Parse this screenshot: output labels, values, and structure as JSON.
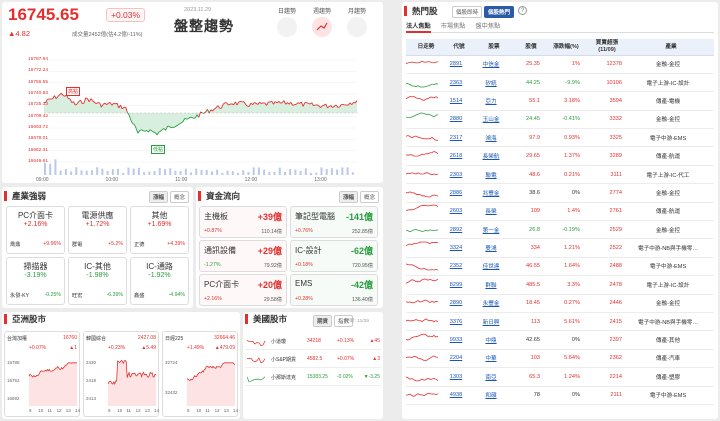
{
  "index": {
    "value": "16745.65",
    "pct": "+0.03%",
    "change": "▲4.82",
    "date": "2023.11.29",
    "volume": "成交量2452億(估4.2億/-11%)",
    "title": "盤整趨勢"
  },
  "views": [
    {
      "label": "日趨勢"
    },
    {
      "label": "週趨勢"
    },
    {
      "label": "月趨勢"
    }
  ],
  "main_chart": {
    "yticks": [
      "16787.94",
      "16772.24",
      "16756.55",
      "16740.83",
      "16725.13",
      "16709.42",
      "16693.72",
      "16678.01",
      "16662.31",
      "16646.61"
    ],
    "xticks": [
      "09:00",
      "10:00",
      "11:00",
      "12:00",
      "13:00"
    ],
    "high_label": "高點",
    "low_label": "低點"
  },
  "industry": {
    "title": "產業強弱",
    "tab1": "漲幅",
    "tab2": "概念",
    "cards": [
      {
        "name": "PC介面卡",
        "pct": "+2.16%",
        "stock": "喬鼎",
        "spct": "+9.96%",
        "dir": "up"
      },
      {
        "name": "電源供應",
        "pct": "+1.72%",
        "stock": "群電",
        "spct": "+5.2%",
        "dir": "up"
      },
      {
        "name": "其他",
        "pct": "+1.69%",
        "stock": "正德",
        "spct": "+4.39%",
        "dir": "up"
      },
      {
        "name": "掃描器",
        "pct": "-3.19%",
        "stock": "永發-KY",
        "spct": "-0.25%",
        "dir": "dn"
      },
      {
        "name": "IC-其他",
        "pct": "-1.98%",
        "stock": "旺宏",
        "spct": "-6.39%",
        "dir": "dn"
      },
      {
        "name": "IC-通路",
        "pct": "-1.92%",
        "stock": "鑫盛",
        "spct": "-4.94%",
        "dir": "dn"
      }
    ]
  },
  "capital": {
    "title": "資金流向",
    "tab1": "漲幅",
    "tab2": "概念",
    "cards": [
      {
        "name": "主機板",
        "amt": "+39億",
        "pct": "+0.87%",
        "val": "110.14億",
        "dir": "up"
      },
      {
        "name": "筆記型電腦",
        "amt": "-141億",
        "pct": "+0.76%",
        "val": "252.85億",
        "dir": "dn"
      },
      {
        "name": "通訊設備",
        "amt": "+29億",
        "pct": "-1.27%",
        "val": "79.92億",
        "dir": "up"
      },
      {
        "name": "IC-設計",
        "amt": "-62億",
        "pct": "+0.18%",
        "val": "720.95億",
        "dir": "dn"
      },
      {
        "name": "PC介面卡",
        "amt": "+20億",
        "pct": "+2.16%",
        "val": "29.58億",
        "dir": "up"
      },
      {
        "name": "EMS",
        "amt": "-42億",
        "pct": "+0.28%",
        "val": "136.40億",
        "dir": "dn"
      }
    ]
  },
  "asia": {
    "title": "亞洲股市",
    "charts": [
      {
        "name": "台灣加權",
        "value": "16760",
        "pct": "+0.07%",
        "chg": "▲1",
        "yt": [
          "16788",
          "16752",
          "16692"
        ],
        "dir": "up"
      },
      {
        "name": "韓國綜合",
        "value": "2427.08",
        "pct": "+0.23%",
        "chg": "▲5.49",
        "yt": [
          "2430",
          "2418",
          "2413"
        ],
        "dir": "up"
      },
      {
        "name": "日經225",
        "value": "32664.46",
        "pct": "+1.49%",
        "chg": "▲479.09",
        "yt": [
          "32724",
          "32432"
        ],
        "dir": "up"
      }
    ],
    "xt": [
      "9",
      "10",
      "11",
      "12",
      "13",
      "14"
    ]
  },
  "us": {
    "title": "美國股市",
    "tab1": "期貨",
    "tab2": "指數",
    "time": "更新: 11/29",
    "rows": [
      {
        "name": "小道瓊",
        "val": "34218",
        "pct": "+0.13%",
        "chg": "▲45",
        "dir": "up"
      },
      {
        "name": "小S&P期貨",
        "val": "4582.5",
        "pct": "+0.07%",
        "chg": "▲3",
        "dir": "up"
      },
      {
        "name": "小那斯達克",
        "val": "15383.25",
        "pct": "-0.02%",
        "chg": "▼-3.25",
        "dir": "dn"
      }
    ]
  },
  "hot": {
    "title": "熱門股",
    "tab1": "個股即時",
    "tab2": "個股熱門",
    "help": "?",
    "subtabs": [
      "法人焦點",
      "市場焦點",
      "盤中焦點"
    ],
    "headers": [
      "日走勢",
      "代號",
      "股票",
      "股價",
      "漲跌幅(%)",
      "買賣超張\n(11/09)",
      "產業"
    ],
    "rows": [
      {
        "code": "2891",
        "name": "中信金",
        "price": "25.35",
        "pct": "1%",
        "vol": "12378",
        "ind": "金融-金控",
        "dir": "up"
      },
      {
        "code": "2363",
        "name": "矽統",
        "price": "44.25",
        "pct": "-9.9%",
        "vol": "10106",
        "ind": "電子上游-IC-設計",
        "dir": "dn"
      },
      {
        "code": "1514",
        "name": "亞力",
        "price": "55.1",
        "pct": "3.18%",
        "vol": "3594",
        "ind": "傳產-電機",
        "dir": "up"
      },
      {
        "code": "2880",
        "name": "玉山金",
        "price": "24.45",
        "pct": "-0.41%",
        "vol": "3332",
        "ind": "金融-金控",
        "dir": "dn"
      },
      {
        "code": "2317",
        "name": "鴻海",
        "price": "97.9",
        "pct": "0.93%",
        "vol": "3325",
        "ind": "電子中游-EMS",
        "dir": "up"
      },
      {
        "code": "2618",
        "name": "長榮航",
        "price": "29.65",
        "pct": "1.37%",
        "vol": "3289",
        "ind": "傳產-航運",
        "dir": "up"
      },
      {
        "code": "2303",
        "name": "聯電",
        "price": "48.6",
        "pct": "0.21%",
        "vol": "3111",
        "ind": "電子上游-IC-代工",
        "dir": "up"
      },
      {
        "code": "2886",
        "name": "兆豐金",
        "price": "38.6",
        "pct": "0%",
        "vol": "2774",
        "ind": "金融-金控",
        "dir": "flat"
      },
      {
        "code": "2603",
        "name": "長榮",
        "price": "109",
        "pct": "1.4%",
        "vol": "2761",
        "ind": "傳產-航運",
        "dir": "up"
      },
      {
        "code": "2892",
        "name": "第一金",
        "price": "26.8",
        "pct": "-0.19%",
        "vol": "2529",
        "ind": "金融-金控",
        "dir": "dn"
      },
      {
        "code": "3324",
        "name": "雙鴻",
        "price": "334",
        "pct": "1.21%",
        "vol": "2522",
        "ind": "電子中游-NB與手機零…",
        "dir": "up"
      },
      {
        "code": "2352",
        "name": "佳世達",
        "price": "46.55",
        "pct": "1.64%",
        "vol": "2488",
        "ind": "電子中游-EMS",
        "dir": "up"
      },
      {
        "code": "8299",
        "name": "群聯",
        "price": "485.5",
        "pct": "3.3%",
        "vol": "2478",
        "ind": "電子上游-IC-設計",
        "dir": "up"
      },
      {
        "code": "2890",
        "name": "永豐金",
        "price": "18.45",
        "pct": "0.27%",
        "vol": "2446",
        "ind": "金融-金控",
        "dir": "up"
      },
      {
        "code": "3376",
        "name": "新日興",
        "price": "113",
        "pct": "5.61%",
        "vol": "2415",
        "ind": "電子中游-NB與手機零…",
        "dir": "up"
      },
      {
        "code": "9933",
        "name": "中鼎",
        "price": "42.65",
        "pct": "0%",
        "vol": "2397",
        "ind": "傳產-其他",
        "dir": "flat"
      },
      {
        "code": "2204",
        "name": "中華",
        "price": "103",
        "pct": "5.64%",
        "vol": "2362",
        "ind": "傳產-汽車",
        "dir": "up"
      },
      {
        "code": "1303",
        "name": "南亞",
        "price": "65.3",
        "pct": "1.24%",
        "vol": "2214",
        "ind": "傳產-塑膠",
        "dir": "up"
      },
      {
        "code": "4938",
        "name": "和碩",
        "price": "78",
        "pct": "0%",
        "vol": "2111",
        "ind": "電子中游-EMS",
        "dir": "flat"
      }
    ]
  },
  "colors": {
    "up": "#e3302f",
    "down": "#2a9d3f"
  }
}
